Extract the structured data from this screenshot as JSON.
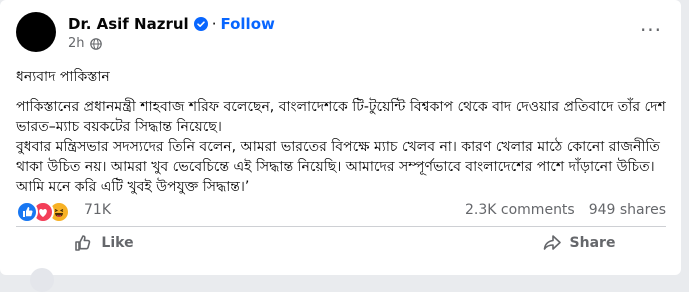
{
  "post": {
    "author": "Dr. Asif Nazrul",
    "follow_label": "Follow",
    "separator": "·",
    "time": "2h",
    "more_label": "···",
    "headline": "ধন্যবাদ পাকিস্তান",
    "paragraph_1": "পাকিস্তানের প্রধানমন্ত্রী শাহবাজ শরিফ বলেছেন, বাংলাদেশকে টি-টুয়েন্টি বিশ্বকাপ থেকে বাদ দেওয়ার প্রতিবাদে তাঁর দেশ ভারত–ম্যাচ বয়কটের সিদ্ধান্ত নিয়েছে।",
    "paragraph_2": "বুধবার মন্ত্রিসভার সদস্যদের তিনি বলেন, আমরা ভারতের বিপক্ষে ম্যাচ খেলব না। কারণ খেলার মাঠে কোনো রাজনীতি থাকা উচিত নয়। আমরা খুব ভেবেচিন্তে এই সিদ্ধান্ত নিয়েছি। আমাদের সম্পূর্ণভাবে বাংলাদেশের পাশে দাঁড়ানো উচিত। আমি মনে করি এটি খুবই উপযুক্ত সিদ্ধান্ত।’"
  },
  "engagement": {
    "reaction_count": "71K",
    "comments": "2.3K comments",
    "shares": "949 shares",
    "reactions": [
      {
        "icon": "like-reaction-icon",
        "color": "#1877f2"
      },
      {
        "icon": "love-reaction-icon",
        "color": "#f33e58"
      },
      {
        "icon": "haha-reaction-icon",
        "color": "#f7b125"
      }
    ]
  },
  "actions": {
    "like_label": "Like",
    "share_label": "Share"
  },
  "colors": {
    "accent": "#0866ff",
    "secondary_text": "#65676b",
    "primary_text": "#050505"
  }
}
